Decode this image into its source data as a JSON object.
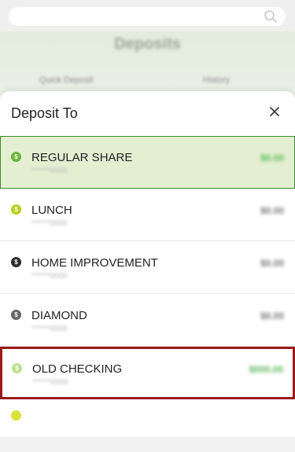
{
  "background": {
    "title": "Deposits",
    "tabs": [
      "Quick Deposit",
      "History"
    ]
  },
  "sheet": {
    "title": "Deposit To",
    "close_icon": "close-icon"
  },
  "accounts": [
    {
      "name": "REGULAR SHARE",
      "sub": "******0000",
      "balance": "$0.00",
      "coin_color": "#6ab63c",
      "state": "selected"
    },
    {
      "name": "LUNCH",
      "sub": "******0000",
      "balance": "$0.00",
      "coin_color": "#b8cf1e",
      "state": "normal"
    },
    {
      "name": "HOME IMPROVEMENT",
      "sub": "******0000",
      "balance": "$0.00",
      "coin_color": "#2b2b2b",
      "state": "normal"
    },
    {
      "name": "DIAMOND",
      "sub": "******0000",
      "balance": "$0.00",
      "coin_color": "#666666",
      "state": "normal"
    },
    {
      "name": "OLD CHECKING",
      "sub": "******0000",
      "balance": "$000.00",
      "coin_color": "#bfe08f",
      "state": "highlight"
    }
  ],
  "colors": {
    "selected_bg": "#e4efd2",
    "selected_border": "#3c8a2e",
    "highlight_border": "#9b1b1b",
    "balance_green": "#5cb85c"
  }
}
